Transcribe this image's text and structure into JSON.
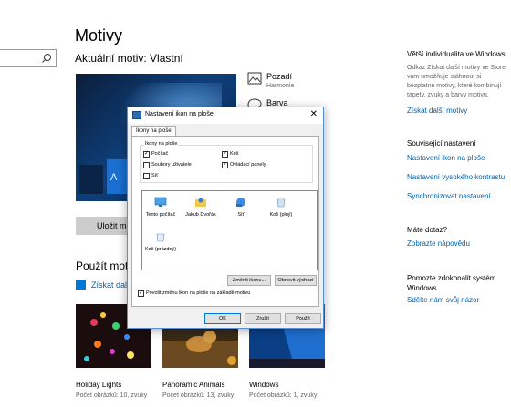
{
  "page": {
    "title": "Motivy",
    "current_theme": "Aktuální motiv: Vlastní",
    "save_button": "Uložit mot",
    "use_heading": "Použít motiv",
    "get_more_link": "Získat další",
    "preview_text": "A"
  },
  "properties": [
    {
      "title": "Pozadí",
      "subtitle": "Harmonie"
    },
    {
      "title": "Barva",
      "subtitle": ""
    }
  ],
  "themes": [
    {
      "name": "Holiday Lights",
      "details": "Počet obrázků: 10, zvuky"
    },
    {
      "name": "Panoramic Animals",
      "details": "Počet obrázků: 13, zvuky"
    },
    {
      "name": "Windows",
      "details": "Počet obrázků: 1, zvuky"
    }
  ],
  "right_pane": {
    "more_heading": "Větší individualita ve Windows",
    "more_text": "Odkaz Získat další motivy ve Store vám umožňuje stáhnout si bezplatné motivy, které kombinují tapety, zvuky a barvy motivu.",
    "more_link": "Získat další motivy",
    "related_heading": "Související nastavení",
    "related_links": [
      "Nastavení ikon na ploše",
      "Nastavení vysokého kontrastu",
      "Synchronizovat nastavení"
    ],
    "question_heading": "Máte dotaz?",
    "question_link": "Zobrazte nápovědu",
    "improve_heading": "Pomozte zdokonalit systém Windows",
    "improve_link": "Sdělte nám svůj názor"
  },
  "dialog": {
    "title": "Nastavení ikon na ploše",
    "close": "✕",
    "tab": "Ikony na ploše",
    "group_label": "Ikony na ploše",
    "checkboxes": [
      {
        "label": "Počítač",
        "checked": true
      },
      {
        "label": "Koš",
        "checked": true
      },
      {
        "label": "Soubory uživatele",
        "checked": false
      },
      {
        "label": "Ovládací panely",
        "checked": true
      },
      {
        "label": "Síť",
        "checked": false
      }
    ],
    "icons": [
      "Tento počítač",
      "Jakub Dvořák",
      "Síť",
      "Koš (plný)",
      "Koš (prázdný)"
    ],
    "change_icon_button": "Změnit ikonu...",
    "restore_default_button": "Obnovit výchozí",
    "allow_themes_label": "Povolit změnu ikon na ploše na základě motivu",
    "allow_themes_checked": true,
    "ok_button": "OK",
    "cancel_button": "Zrušit",
    "apply_button": "Použít"
  },
  "colors": {
    "accent": "#0078d7",
    "link": "#0063b1"
  }
}
